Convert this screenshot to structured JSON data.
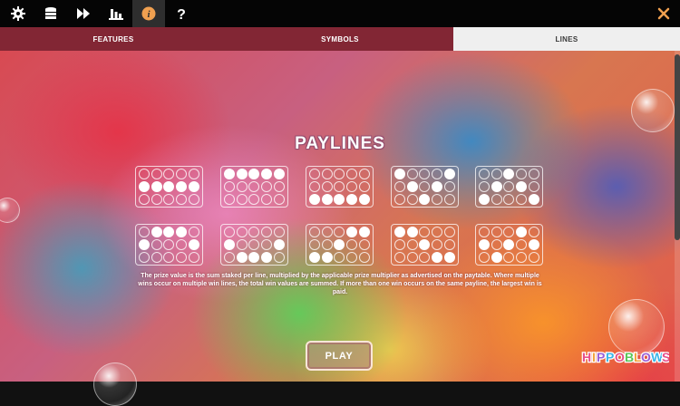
{
  "toolbar": {
    "buttons": [
      {
        "name": "settings-button",
        "icon": "gear-icon"
      },
      {
        "name": "bet-button",
        "icon": "coins-stack-icon"
      },
      {
        "name": "autoplay-button",
        "icon": "fast-forward-icon"
      },
      {
        "name": "stats-button",
        "icon": "bar-chart-icon"
      },
      {
        "name": "info-button",
        "icon": "info-icon",
        "active": true
      },
      {
        "name": "help-button",
        "icon": "question-mark-icon"
      }
    ],
    "close_icon": "close-icon",
    "accent_color": "#f0a050"
  },
  "tabs": [
    {
      "label": "FEATURES",
      "active": false
    },
    {
      "label": "SYMBOLS",
      "active": false
    },
    {
      "label": "LINES",
      "active": true
    }
  ],
  "page": {
    "title": "PAYLINES",
    "description": "The prize value is the sum staked per line, multiplied by the applicable prize multiplier as advertised on the paytable. Where multiple wins occur on multiple win lines, the total win values are summed. If more than one win occurs on the same payline, the largest win is paid.",
    "play_label": "PLAY",
    "logo_text": "HIPPOBLOWS"
  },
  "paylines": [
    [
      1,
      1,
      1,
      1,
      1
    ],
    [
      0,
      0,
      0,
      0,
      0
    ],
    [
      2,
      2,
      2,
      2,
      2
    ],
    [
      0,
      1,
      2,
      1,
      0
    ],
    [
      2,
      1,
      0,
      1,
      2
    ],
    [
      1,
      0,
      0,
      0,
      1
    ],
    [
      1,
      2,
      2,
      2,
      1
    ],
    [
      2,
      2,
      1,
      0,
      0
    ],
    [
      0,
      0,
      1,
      2,
      2
    ],
    [
      1,
      2,
      1,
      0,
      1
    ]
  ]
}
